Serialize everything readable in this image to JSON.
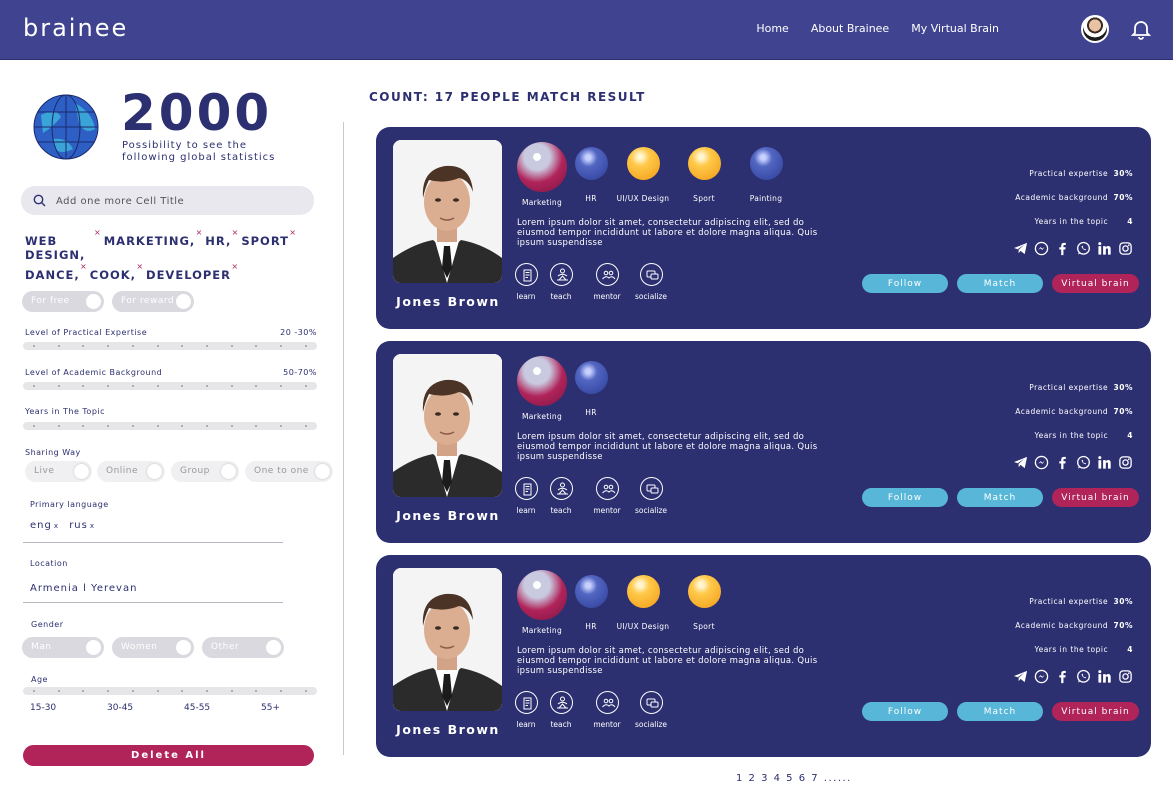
{
  "header": {
    "logo": "brainee",
    "nav": [
      "Home",
      "About Brainee",
      "My Virtual Brain"
    ]
  },
  "sidebar": {
    "stat_number": "2000",
    "stat_desc": "Possibility to see the following global statistics",
    "search_placeholder": "Add one more Cell Title",
    "tags_row1": [
      "WEB DESIGN,",
      "MARKETING,",
      "HR,",
      "SPORT"
    ],
    "tags_row2": [
      "DANCE,",
      "COOK,",
      "DEVELOPER"
    ],
    "tag_remove": "×",
    "reward_toggles": [
      "For free",
      "For reward"
    ],
    "practical_label": "Level of Practical Expertise",
    "practical_value": "20 -30%",
    "academic_label": "Level of Academic Background",
    "academic_value": "50-70%",
    "years_label": "Years in The Topic",
    "sharing_label": "Sharing Way",
    "sharing_options": [
      "Live",
      "Online",
      "Group",
      "One to one"
    ],
    "language_label": "Primary language",
    "languages": [
      "eng",
      "rus"
    ],
    "lang_remove": "x",
    "location_label": "Location",
    "location_value": "Armenia l Yerevan",
    "gender_label": "Gender",
    "gender_options": [
      "Man",
      "Women",
      "Other"
    ],
    "age_label": "Age",
    "age_ticks": [
      "15-30",
      "30-45",
      "45-55",
      "55+"
    ],
    "delete_all": "Delete All"
  },
  "results": {
    "count_text": "COUNT: 17 PEOPLE MATCH RESULT",
    "pagination": "1 2 3 4 5 6 7 ......",
    "cards": [
      {
        "name": "Jones Brown",
        "topics": [
          "Marketing",
          "HR",
          "UI/UX Design",
          "Sport",
          "Painting"
        ],
        "bio": "Lorem ipsum dolor sit amet, consectetur adipiscing elit, sed do eiusmod tempor incididunt ut labore et dolore magna aliqua. Quis ipsum suspendisse",
        "actions": [
          "learn",
          "teach",
          "mentor",
          "socialize"
        ],
        "practical_label": "Practical expertise",
        "practical": "30%",
        "academic_label": "Academic background",
        "academic": "70%",
        "years_label": "Years in the topic",
        "years": "4",
        "follow": "Follow",
        "match": "Match",
        "virtual_brain": "Virtual brain"
      },
      {
        "name": "Jones Brown",
        "topics": [
          "Marketing",
          "HR"
        ],
        "bio": "Lorem ipsum dolor sit amet, consectetur adipiscing elit, sed do eiusmod tempor incididunt ut labore et dolore magna aliqua. Quis ipsum suspendisse",
        "actions": [
          "learn",
          "teach",
          "mentor",
          "socialize"
        ],
        "practical_label": "Practical expertise",
        "practical": "30%",
        "academic_label": "Academic background",
        "academic": "70%",
        "years_label": "Years in the topic",
        "years": "4",
        "follow": "Follow",
        "match": "Match",
        "virtual_brain": "Virtual brain"
      },
      {
        "name": "Jones Brown",
        "topics": [
          "Marketing",
          "HR",
          "UI/UX Design",
          "Sport"
        ],
        "bio": "Lorem ipsum dolor sit amet, consectetur adipiscing elit, sed do eiusmod tempor incididunt ut labore et dolore magna aliqua. Quis ipsum suspendisse",
        "actions": [
          "learn",
          "teach",
          "mentor",
          "socialize"
        ],
        "practical_label": "Practical expertise",
        "practical": "30%",
        "academic_label": "Academic background",
        "academic": "70%",
        "years_label": "Years in the topic",
        "years": "4",
        "follow": "Follow",
        "match": "Match",
        "virtual_brain": "Virtual brain"
      }
    ]
  },
  "colors": {
    "header": "#3f4390",
    "navy": "#2c2f70",
    "accent_pink": "#b0245a",
    "accent_cyan": "#58b7d8",
    "orange": "#f29a14"
  }
}
